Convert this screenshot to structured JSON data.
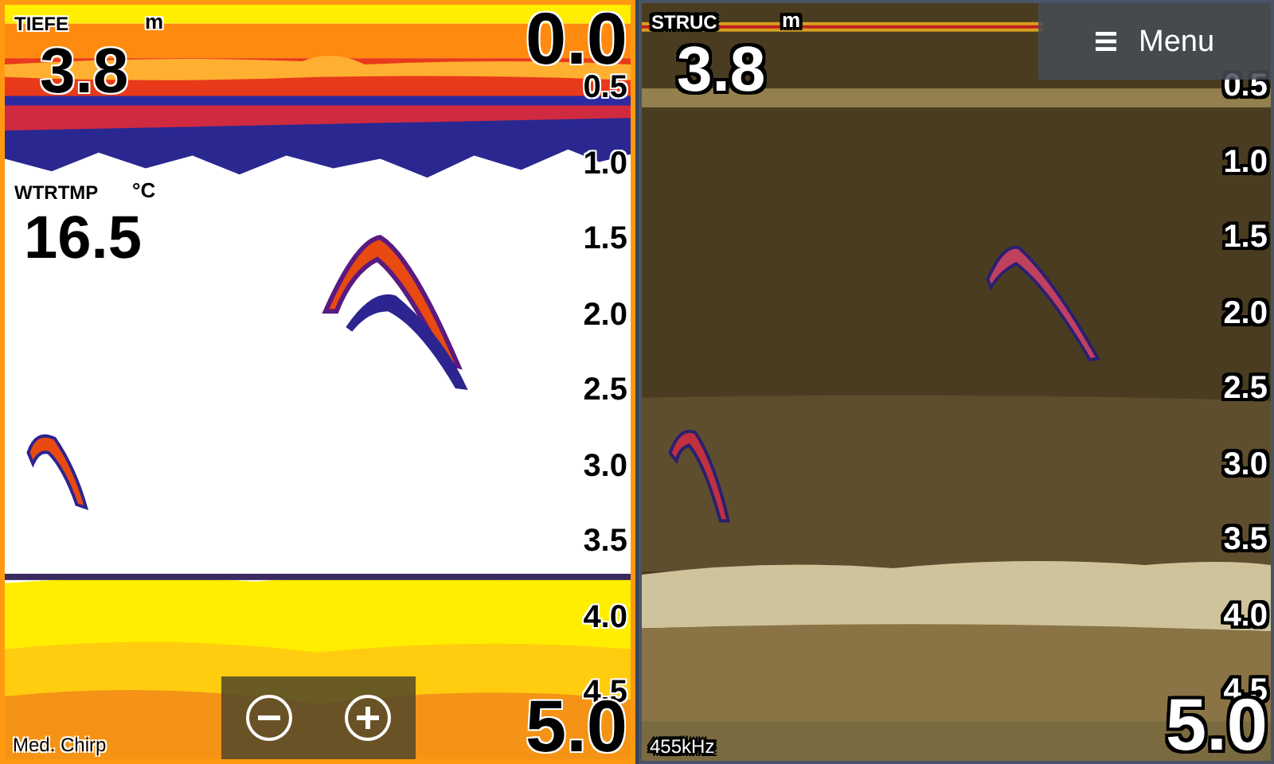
{
  "panes": [
    {
      "kind": "chirp",
      "selected": true,
      "depth_label": "TIEFE",
      "depth_unit": "m",
      "depth_value": "3.8",
      "temp_label": "WTRTMP",
      "temp_unit": "°C",
      "temp_value": "16.5",
      "scale": [
        {
          "kind": "major",
          "text": "0.0"
        },
        {
          "kind": "minor",
          "text": "0.5"
        },
        {
          "kind": "minor",
          "text": "1.0"
        },
        {
          "kind": "minor",
          "text": "1.5"
        },
        {
          "kind": "minor",
          "text": "2.0"
        },
        {
          "kind": "minor",
          "text": "2.5"
        },
        {
          "kind": "minor",
          "text": "3.0"
        },
        {
          "kind": "minor",
          "text": "3.5"
        },
        {
          "kind": "minor",
          "text": "4.0"
        },
        {
          "kind": "minor",
          "text": "4.5"
        },
        {
          "kind": "major",
          "text": "5.0"
        }
      ],
      "frequency": "Med. Chirp",
      "zoom_controls": true
    },
    {
      "kind": "structure",
      "selected": false,
      "depth_label": "STRUC",
      "depth_unit": "m",
      "depth_value": "3.8",
      "scale": [
        {
          "kind": "minor",
          "text": "0.5"
        },
        {
          "kind": "minor",
          "text": "1.0"
        },
        {
          "kind": "minor",
          "text": "1.5"
        },
        {
          "kind": "minor",
          "text": "2.0"
        },
        {
          "kind": "minor",
          "text": "2.5"
        },
        {
          "kind": "minor",
          "text": "3.0"
        },
        {
          "kind": "minor",
          "text": "3.5"
        },
        {
          "kind": "minor",
          "text": "4.0"
        },
        {
          "kind": "minor",
          "text": "4.5"
        },
        {
          "kind": "major",
          "text": "5.0"
        }
      ],
      "frequency": "455kHz",
      "menu": {
        "label": "Menu"
      }
    }
  ]
}
